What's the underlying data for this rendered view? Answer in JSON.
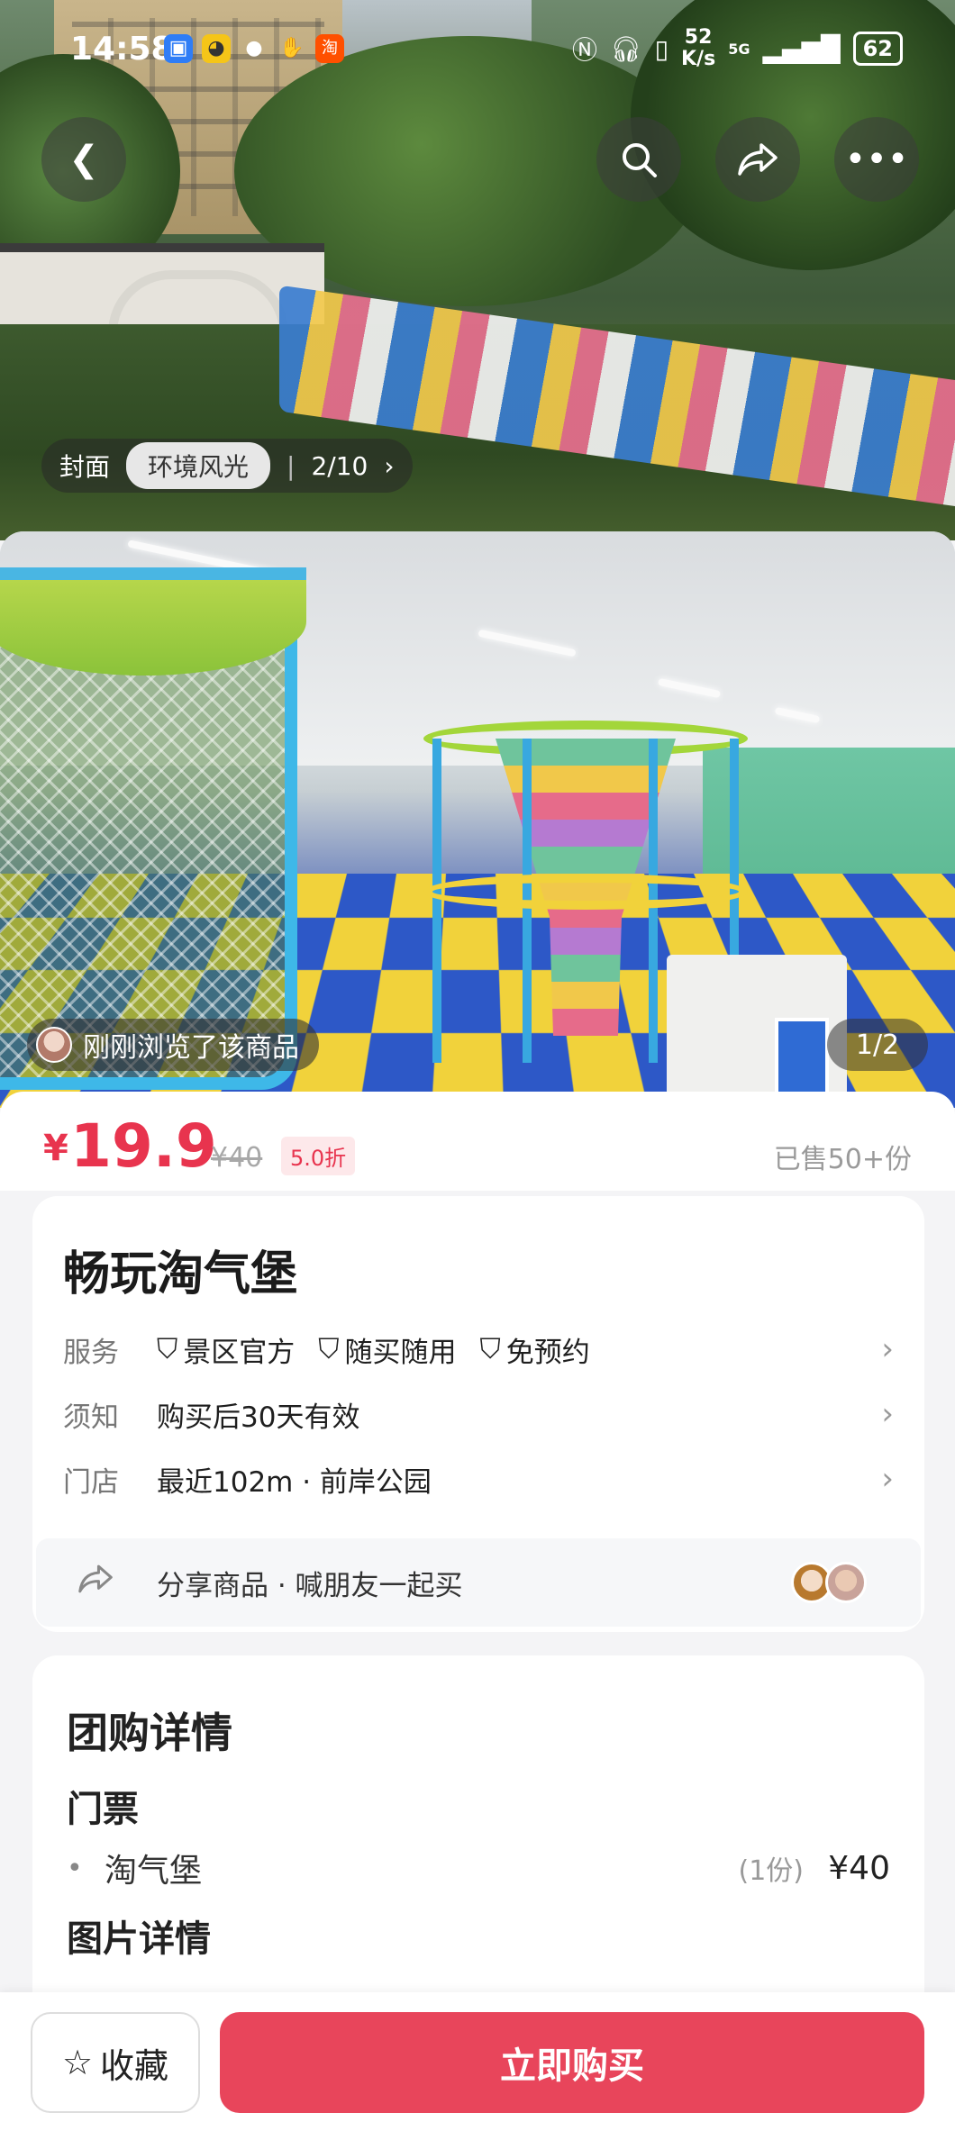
{
  "status_bar": {
    "time": "14:58",
    "net_speed_value": "52",
    "net_speed_unit": "K/s",
    "network": "5G",
    "battery": "62"
  },
  "gallery": {
    "tab_cover": "封面",
    "tab_scenery": "环境风光",
    "counter": "2/10"
  },
  "photo2": {
    "browsed_label": "刚刚浏览了该商品",
    "counter": "1/2"
  },
  "price": {
    "currency": "¥",
    "value": "19.9",
    "original": "¥40",
    "discount": "5.0折",
    "sold": "已售50+份",
    "accent_color": "#e8344e"
  },
  "product": {
    "title": "畅玩淘气堡",
    "rows": [
      {
        "key": "服务",
        "tags": [
          "景区官方",
          "随买随用",
          "免预约"
        ]
      },
      {
        "key": "须知",
        "value": "购买后30天有效"
      },
      {
        "key": "门店",
        "value": "最近102m · 前岸公园"
      }
    ],
    "share_text": "分享商品 · 喊朋友一起买"
  },
  "details": {
    "title": "团购详情",
    "ticket_title": "门票",
    "ticket_item": "淘气堡",
    "ticket_qty": "(1份)",
    "ticket_price": "¥40",
    "photo_title": "图片详情"
  },
  "bottom": {
    "fav_label": "收藏",
    "buy_label": "立即购买",
    "buy_color": "#e8455b"
  }
}
